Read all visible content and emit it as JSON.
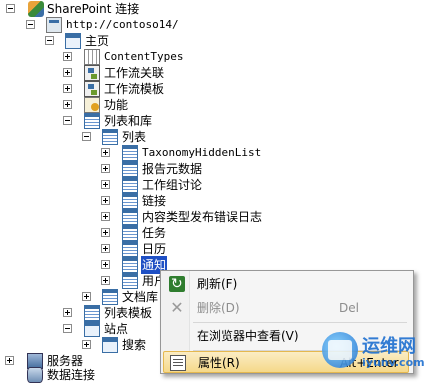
{
  "tree": {
    "root": "SharePoint 连接",
    "site": "http://contoso14/",
    "home": "主页",
    "content_types": "ContentTypes",
    "workflow_assoc": "工作流关联",
    "workflow_templates": "工作流模板",
    "features": "功能",
    "lists_libraries": "列表和库",
    "lists": "列表",
    "lists_items": [
      "TaxonomyHiddenList",
      "报告元数据",
      "工作组讨论",
      "链接",
      "内容类型发布错误日志",
      "任务",
      "日历",
      "通知",
      "用户"
    ],
    "doc_libs": "文档库",
    "list_templates": "列表模板",
    "sites": "站点",
    "search": "搜索",
    "servers": "服务器",
    "data_connections": "数据连接"
  },
  "menu": {
    "refresh": {
      "label": "刷新(F)",
      "shortcut": ""
    },
    "delete": {
      "label": "删除(D)",
      "shortcut": "Del"
    },
    "view_browser": {
      "label": "在浏览器中查看(V)",
      "shortcut": ""
    },
    "properties": {
      "label": "属性(R)",
      "shortcut": "Alt+Enter"
    }
  },
  "watermark": {
    "title": "运维网",
    "url": "iyunv.com"
  }
}
